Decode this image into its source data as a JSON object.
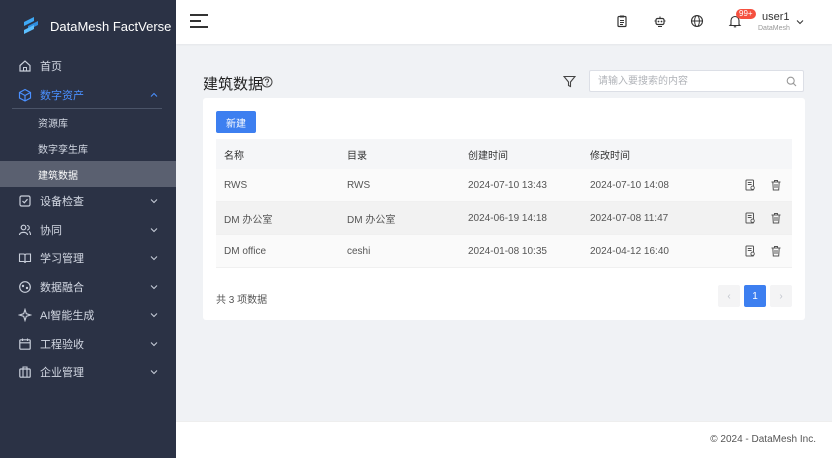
{
  "brand": {
    "name": "DataMesh FactVerse"
  },
  "sidebar": {
    "items": [
      {
        "label": "首页",
        "icon": "home-icon"
      },
      {
        "label": "数字资产",
        "icon": "cube-icon",
        "active": true,
        "children": [
          {
            "label": "资源库"
          },
          {
            "label": "数字孪生库"
          },
          {
            "label": "建筑数据",
            "selected": true
          }
        ]
      },
      {
        "label": "设备检查",
        "icon": "checklist-icon"
      },
      {
        "label": "协同",
        "icon": "users-icon"
      },
      {
        "label": "学习管理",
        "icon": "book-icon"
      },
      {
        "label": "数据融合",
        "icon": "data-fusion-icon"
      },
      {
        "label": "AI智能生成",
        "icon": "ai-sparkle-icon"
      },
      {
        "label": "工程验收",
        "icon": "calendar-icon"
      },
      {
        "label": "企业管理",
        "icon": "building-icon"
      }
    ]
  },
  "header": {
    "notification_badge": "99+",
    "user_name": "user1",
    "user_org": "DataMesh"
  },
  "main": {
    "title": "建筑数据",
    "search": {
      "placeholder": "请输入要搜索的内容",
      "value": ""
    },
    "new_button": "新建",
    "table": {
      "columns": [
        "名称",
        "目录",
        "创建时间",
        "修改时间"
      ],
      "rows": [
        {
          "name": "RWS",
          "dir": "RWS",
          "created": "2024-07-10 13:43",
          "modified": "2024-07-10 14:08"
        },
        {
          "name": "DM 办公室",
          "dir": "DM 办公室",
          "created": "2024-06-19 14:18",
          "modified": "2024-07-08 11:47"
        },
        {
          "name": "DM office",
          "dir": "ceshi",
          "created": "2024-01-08 10:35",
          "modified": "2024-04-12 16:40"
        }
      ]
    },
    "total_text": "共 3 项数据",
    "pagination": {
      "prev": "‹",
      "current": "1",
      "next": "›"
    }
  },
  "footer": {
    "text": "© 2024 - DataMesh Inc."
  },
  "colors": {
    "sidebar_bg": "#2b3245",
    "accent": "#3d7ff0",
    "badge": "#f5503f"
  }
}
